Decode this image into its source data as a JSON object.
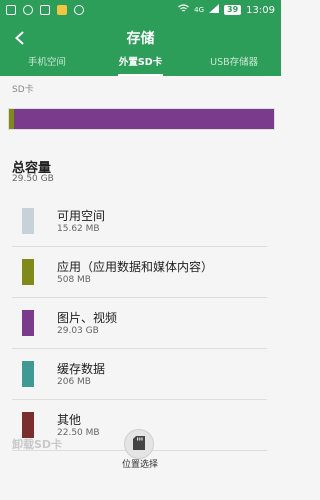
{
  "status_bar": {
    "time": "13:09",
    "battery": "39",
    "network": "4G"
  },
  "app_bar": {
    "title": "存储",
    "back_icon": "back-chevron-icon"
  },
  "tabs": [
    {
      "label": "手机空间",
      "active": false
    },
    {
      "label": "外置SD卡",
      "active": true
    },
    {
      "label": "USB存储器",
      "active": false
    }
  ],
  "section_label": "SD卡",
  "usage_bar": {
    "segments": [
      {
        "category": "应用（应用数据和媒体内容）",
        "color": "#7f8a1a",
        "fraction": 0.017
      },
      {
        "category": "图片、视频",
        "color": "#7a3b8c",
        "fraction": 0.983
      }
    ]
  },
  "total": {
    "title": "总容量",
    "value": "29.50 GB"
  },
  "items": [
    {
      "name": "可用空间",
      "size": "15.62 MB",
      "color": "#c6d2d8"
    },
    {
      "name": "应用（应用数据和媒体内容）",
      "size": "508 MB",
      "color": "#7f8a1a"
    },
    {
      "name": "图片、视频",
      "size": "29.03 GB",
      "color": "#7a3b8c"
    },
    {
      "name": "缓存数据",
      "size": "206 MB",
      "color": "#3f9a93"
    },
    {
      "name": "其他",
      "size": "22.50 MB",
      "color": "#7a2e2e"
    }
  ],
  "bottom": {
    "ghost_text": "卸载SD卡",
    "fab_label": "位置选择",
    "fab_icon": "sd-card-icon"
  }
}
